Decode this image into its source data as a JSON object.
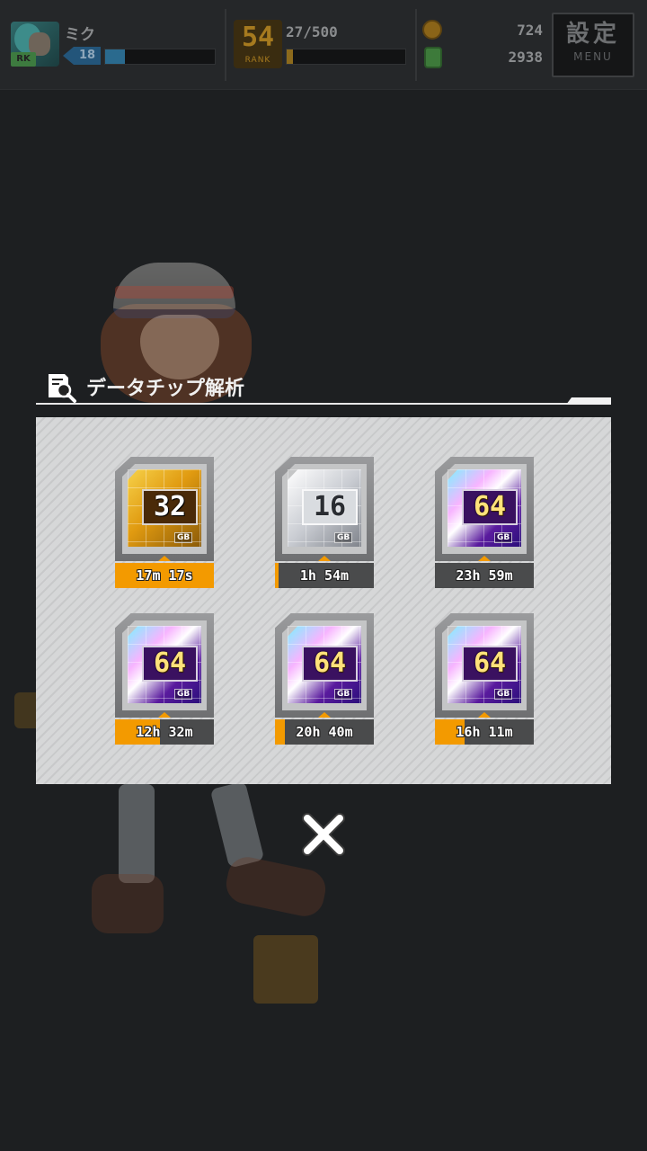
{
  "topbar": {
    "character": {
      "name": "ミク",
      "level": "18",
      "badge": "RK",
      "exp_progress": 0.18
    },
    "rank": {
      "number": "54",
      "label": "RANK",
      "exp": "27/500",
      "progress": 0.054
    },
    "currency": {
      "coins": "724",
      "gems": "2938"
    },
    "menu": {
      "kanji": "設定",
      "label": "MENU"
    }
  },
  "modal": {
    "title": "データチップ解析",
    "chips": [
      {
        "capacity": "32",
        "unit": "GB",
        "style": "gold",
        "timer": "17m 17s",
        "progress": 1.0
      },
      {
        "capacity": "16",
        "unit": "GB",
        "style": "silver",
        "timer": "1h 54m",
        "progress": 0.04
      },
      {
        "capacity": "64",
        "unit": "GB",
        "style": "rainbow",
        "timer": "23h 59m",
        "progress": 0.0
      },
      {
        "capacity": "64",
        "unit": "GB",
        "style": "rainbow",
        "timer": "12h 32m",
        "progress": 0.45
      },
      {
        "capacity": "64",
        "unit": "GB",
        "style": "rainbow",
        "timer": "20h 40m",
        "progress": 0.1
      },
      {
        "capacity": "64",
        "unit": "GB",
        "style": "rainbow",
        "timer": "16h 11m",
        "progress": 0.3
      }
    ],
    "close_icon": "close-x-icon"
  },
  "colors": {
    "accent_orange": "#f39a00",
    "panel": "#cfd0d1",
    "title_text": "#f1f1f1"
  }
}
